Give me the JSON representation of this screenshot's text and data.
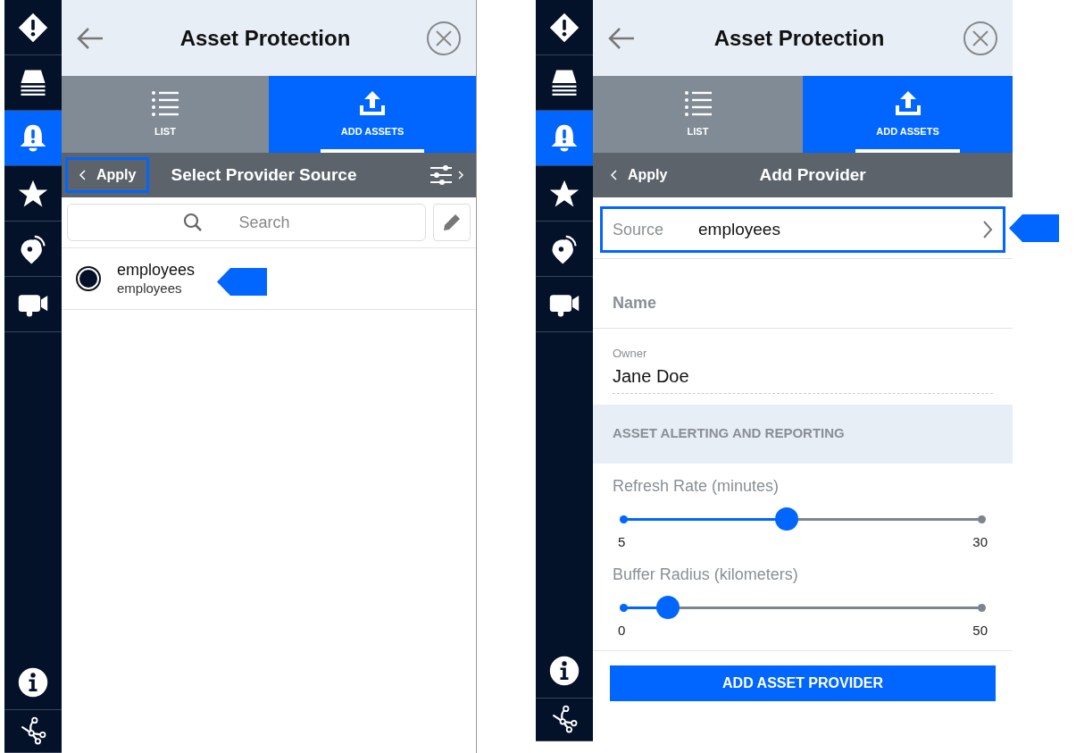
{
  "panels": [
    {
      "kind": "select_source",
      "sidebar": {
        "top_items": [
          {
            "kind": "alert",
            "selected": false
          },
          {
            "kind": "layers",
            "selected": false
          },
          {
            "kind": "bell",
            "selected": true
          },
          {
            "kind": "star",
            "selected": false
          },
          {
            "kind": "pin",
            "selected": false
          },
          {
            "kind": "video",
            "selected": false
          }
        ],
        "bottom_items": [
          {
            "kind": "info",
            "selected": false
          },
          {
            "kind": "network",
            "selected": false
          }
        ]
      },
      "title": "Asset Protection",
      "tabs": [
        {
          "kind": "list",
          "label": "LIST",
          "selected": false
        },
        {
          "kind": "upload",
          "label": "ADD ASSETS",
          "selected": true
        }
      ],
      "subheader": {
        "back": "Apply",
        "back_highlighted": true,
        "title": "Select Provider Source",
        "filter": true
      },
      "search": {
        "placeholder": "Search"
      },
      "list": [
        {
          "title": "employees",
          "subtitle": "employees",
          "selected": true,
          "callout": true
        }
      ]
    },
    {
      "kind": "add_provider",
      "sidebar": {
        "top_items": [
          {
            "kind": "alert",
            "selected": false
          },
          {
            "kind": "layers",
            "selected": false
          },
          {
            "kind": "bell",
            "selected": true
          },
          {
            "kind": "star",
            "selected": false
          },
          {
            "kind": "pin",
            "selected": false
          },
          {
            "kind": "video",
            "selected": false
          }
        ],
        "bottom_items": [
          {
            "kind": "info",
            "selected": false
          },
          {
            "kind": "network",
            "selected": false
          }
        ]
      },
      "title": "Asset Protection",
      "tabs": [
        {
          "kind": "list",
          "label": "LIST",
          "selected": false
        },
        {
          "kind": "upload",
          "label": "ADD ASSETS",
          "selected": true
        }
      ],
      "subheader": {
        "back": "Apply",
        "back_highlighted": false,
        "title": "Add Provider",
        "filter": false
      },
      "source": {
        "label": "Source",
        "value": "employees",
        "highlighted": true,
        "callout": true
      },
      "name_field": {
        "placeholder": "Name"
      },
      "owner_field": {
        "label": "Owner",
        "value": "Jane Doe"
      },
      "section": "ASSET ALERTING AND REPORTING",
      "sliders": [
        {
          "label": "Refresh Rate (minutes)",
          "level": 0.455,
          "min": "5",
          "max": "30"
        },
        {
          "label": "Buffer Radius (kilometers)",
          "level": 0.124,
          "min": "0",
          "max": "50"
        }
      ],
      "button": "ADD ASSET PROVIDER"
    }
  ]
}
